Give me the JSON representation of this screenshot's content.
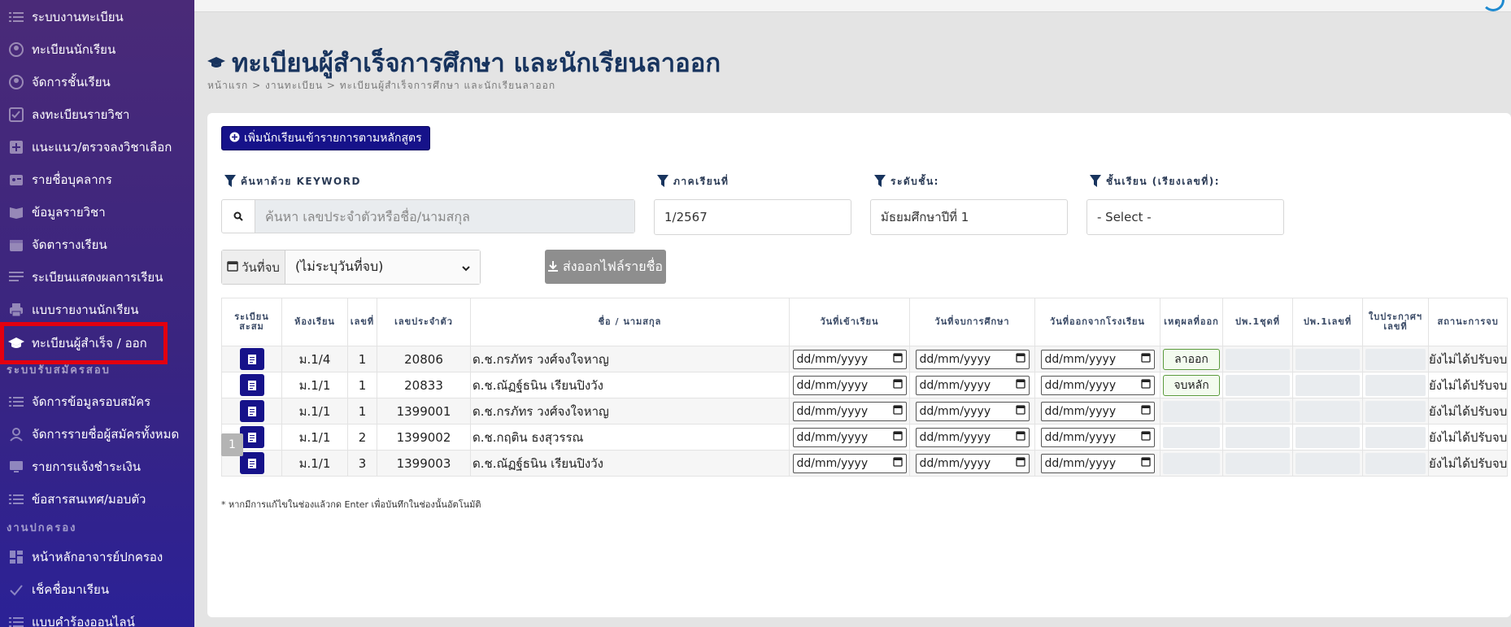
{
  "sidebar": {
    "items": [
      {
        "label": "ระบบงานทะเบียน",
        "icon": "list-icon"
      },
      {
        "label": "ทะเบียนนักเรียน",
        "icon": "user-circle-icon"
      },
      {
        "label": "จัดการชั้นเรียน",
        "icon": "user-circle-icon"
      },
      {
        "label": "ลงทะเบียนรายวิชา",
        "icon": "checklist-icon"
      },
      {
        "label": "แนะแนว/ตรวจลงวิชาเลือก",
        "icon": "medical-plus-icon"
      },
      {
        "label": "รายชื่อบุคลากร",
        "icon": "id-card-icon"
      },
      {
        "label": "ข้อมูลรายวิชา",
        "icon": "book-icon"
      },
      {
        "label": "จัดตารางเรียน",
        "icon": "calendar-icon"
      },
      {
        "label": "ระเบียนแสดงผลการเรียน",
        "icon": "document-lines-icon"
      },
      {
        "label": "แบบรายงานนักเรียน",
        "icon": "printer-icon"
      },
      {
        "label": "ทะเบียนผู้สำเร็จ / ออก",
        "icon": "graduation-cap-icon"
      }
    ],
    "section_admission": "ระบบรับสมัครสอบ",
    "admission_items": [
      {
        "label": "จัดการข้อมูลรอบสมัคร",
        "icon": "list-icon"
      },
      {
        "label": "จัดการรายชื่อผู้สมัครทั้งหมด",
        "icon": "user-icon"
      },
      {
        "label": "รายการแจ้งชำระเงิน",
        "icon": "monitor-icon"
      },
      {
        "label": "ข้อสารสนเทศ/มอบตัว",
        "icon": "list-icon"
      }
    ],
    "section_governance": "งานปกครอง",
    "governance_items": [
      {
        "label": "หน้าหลักอาจารย์ปกครอง",
        "icon": "dashboard-icon"
      },
      {
        "label": "เช็คชื่อมาเรียน",
        "icon": "check-icon"
      },
      {
        "label": "แบบคำร้องออนไลน์",
        "icon": "list-icon"
      }
    ]
  },
  "header": {
    "title": "ทะเบียนผู้สำเร็จการศึกษา และนักเรียนลาออก",
    "breadcrumb": "หน้าแรก > งานทะเบียน > ทะเบียนผู้สำเร็จการศึกษา และนักเรียนลาออก"
  },
  "toolbar": {
    "add_button": "เพิ่มนักเรียนเข้ารายการตามหลักสูตร",
    "export_button": "ส่งออกไฟล์รายชื่อ"
  },
  "filters": {
    "keyword_label": "ค้นหาด้วย KEYWORD",
    "keyword_placeholder": "ค้นหา เลขประจำตัวหรือชื่อ/นามสกุล",
    "semester_label": "ภาคเรียนที่",
    "semester_value": "1/2567",
    "level_label": "ระดับชั้น:",
    "level_value": "มัธยมศึกษาปีที่ 1",
    "class_label": "ชั้นเรียน (เรียงเลขที่):",
    "class_value": "- Select -",
    "end_date_label": "วันที่จบ",
    "end_date_value": "(ไม่ระบุวันที่จบ)"
  },
  "table": {
    "headers": [
      "ระเบียนสะสม",
      "ห้องเรียน",
      "เลขที่",
      "เลขประจำตัว",
      "ชื่อ / นามสกุล",
      "วันที่เข้าเรียน",
      "วันที่จบการศึกษา",
      "วันที่ออกจากโรงเรียน",
      "เหตุผลที่ออก",
      "ปพ.1ชุดที่",
      "ปพ.1เลขที่",
      "ใบประกาศฯเลขที่",
      "สถานะการจบ"
    ],
    "date_placeholder": "dd/mm/yyyy",
    "rows": [
      {
        "room": "ม.1/4",
        "no": "1",
        "id": "20806",
        "name": "ด.ช.กรภัทร วงศ์จงใจหาญ",
        "reason": "ลาออก",
        "status": "ยังไม่ได้ปรับจบ"
      },
      {
        "room": "ม.1/1",
        "no": "1",
        "id": "20833",
        "name": "ด.ช.ณัฏฐ์ธนิน เรียนปิงวัง",
        "reason": "จบหลัก",
        "status": "ยังไม่ได้ปรับจบ"
      },
      {
        "room": "ม.1/1",
        "no": "1",
        "id": "1399001",
        "name": "ด.ช.กรภัทร วงศ์จงใจหาญ",
        "reason": "",
        "status": "ยังไม่ได้ปรับจบ"
      },
      {
        "room": "ม.1/1",
        "no": "2",
        "id": "1399002",
        "name": "ด.ช.กฤติน ธงสุวรรณ",
        "reason": "",
        "status": "ยังไม่ได้ปรับจบ"
      },
      {
        "room": "ม.1/1",
        "no": "3",
        "id": "1399003",
        "name": "ด.ช.ณัฏฐ์ธนิน เรียนปิงวัง",
        "reason": "",
        "status": "ยังไม่ได้ปรับจบ"
      }
    ]
  },
  "pagination": {
    "current": "1"
  },
  "footnote": "* หากมีการแก้ไขในช่องแล้วกด Enter เพื่อบันทึกในช่องนั้นอัตโนมัติ",
  "colors": {
    "accent": "#16128a",
    "highlight": "#e3000f",
    "sidebar": "#3a2580"
  }
}
